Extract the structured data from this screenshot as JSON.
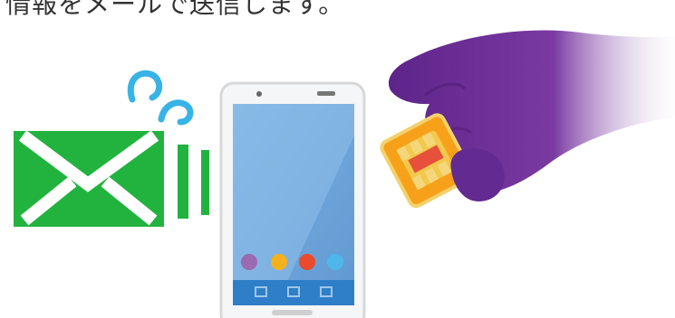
{
  "caption": "情報をメールで送信します。",
  "icons": {
    "email": "envelope-icon",
    "phone": "smartphone-icon",
    "sim": "sim-card-icon",
    "hand": "hand-icon",
    "motion": "motion-lines-icon"
  },
  "colors": {
    "mail_green": "#22b33f",
    "phone_blue": "#6fa7dc",
    "hand_purple": "#6a2d91",
    "sim_orange": "#f7a11a",
    "sim_red": "#e7503a",
    "dock_blue": "#2f7ec8",
    "accent_blue": "#37b3e6"
  },
  "app_dots": [
    "#9c6ab0",
    "#f5b21c",
    "#e94b2d",
    "#4eb7ea"
  ]
}
